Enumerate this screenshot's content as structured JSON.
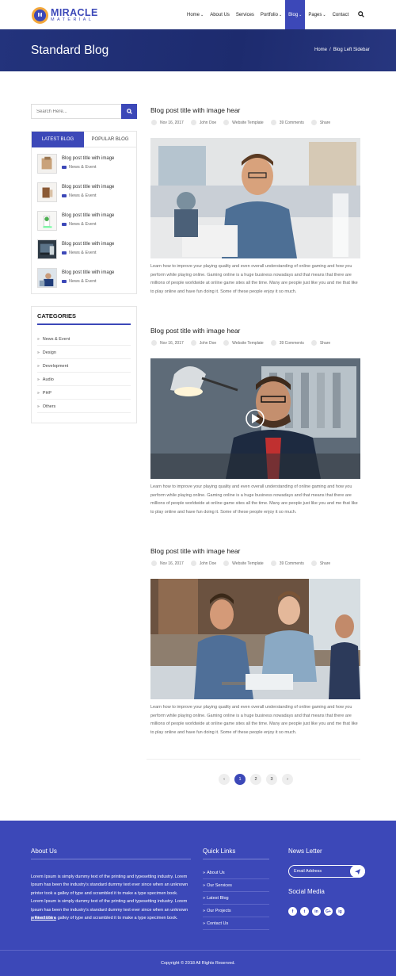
{
  "header": {
    "logo_main": "MIRACLE",
    "logo_sub": "MATERIAL",
    "logo_badge": "M",
    "nav": [
      {
        "label": "Home",
        "dropdown": true,
        "active": false
      },
      {
        "label": "About Us",
        "dropdown": false,
        "active": false
      },
      {
        "label": "Services",
        "dropdown": false,
        "active": false
      },
      {
        "label": "Portfolio",
        "dropdown": true,
        "active": false
      },
      {
        "label": "Blog",
        "dropdown": true,
        "active": true
      },
      {
        "label": "Pages",
        "dropdown": true,
        "active": false
      },
      {
        "label": "Contact",
        "dropdown": false,
        "active": false
      }
    ],
    "search_icon": "search-icon"
  },
  "banner": {
    "title": "Standard Blog",
    "breadcrumb_home": "Home",
    "breadcrumb_sep": "/",
    "breadcrumb_current": "Blog Left Sidebar"
  },
  "sidebar": {
    "search_placeholder": "Search Here...",
    "tab_latest": "LATEST BLOG",
    "tab_popular": "POPULAR BLOG",
    "posts": [
      {
        "title": "Blog post title with image",
        "category": "News & Event"
      },
      {
        "title": "Blog post title with image",
        "category": "News & Event"
      },
      {
        "title": "Blog post title with image",
        "category": "News & Event"
      },
      {
        "title": "Blog post title with image",
        "category": "News & Event"
      },
      {
        "title": "Blog post title with image",
        "category": "News & Event"
      }
    ],
    "categories_title": "CATEGORIES",
    "categories": [
      "News & Event",
      "Design",
      "Development",
      "Audio",
      "PHP",
      "Others"
    ]
  },
  "posts": [
    {
      "title": "Blog post title with image hear",
      "date": "Nov 16, 2017",
      "author": "John Doe",
      "tag": "Website Template",
      "comments": "39 Comments",
      "share": "Share",
      "has_play": false
    },
    {
      "title": "Blog post title with image hear",
      "date": "Nov 16, 2017",
      "author": "John Doe",
      "tag": "Website Template",
      "comments": "39 Comments",
      "share": "Share",
      "has_play": true
    },
    {
      "title": "Blog post title with image hear",
      "date": "Nov 16, 2017",
      "author": "John Doe",
      "tag": "Website Template",
      "comments": "39 Comments",
      "share": "Share",
      "has_play": false
    }
  ],
  "excerpt_lines": [
    "Learn how to improve your playing quality and even overall understanding of online gaming and how you",
    "perform while playing online. Gaming online is a huge business nowadays and that means that there are",
    "millions of people worldwide at online game sites all the time. Many are people just like you and me that like",
    "to play online and have fun doing it. Some of these people enjoy it so much."
  ],
  "pagination": {
    "prev": "‹",
    "pages": [
      "1",
      "2",
      "3"
    ],
    "current": "1",
    "next": "›"
  },
  "footer": {
    "about_title": "About Us",
    "about_text": "Lorem Ipsum is simply dummy text of the printing and typesetting industry. Lorem Ipsum has been the industry's standard dummy text ever since when an unknown printer took a galley of type and scrambled it to make a type specimen book. Lorem Ipsum is simply dummy text of the printing and typesetting industry. Lorem Ipsum has been the industry's standard dummy text ever since when an unknown printer took a galley of type and scrambled it to make a type specimen book.",
    "read_more": "Read More",
    "quick_title": "Quick Links",
    "quick_links": [
      "About Us",
      "Our Services",
      "Latest Blog",
      "Our Projects",
      "Contact Us"
    ],
    "newsletter_title": "News Letter",
    "newsletter_placeholder": "Email Address",
    "social_title": "Social Media",
    "social": [
      "f",
      "t",
      "in",
      "G+",
      "ig"
    ],
    "copyright": "Copyright © 2018 All Rights Reserved."
  },
  "colors": {
    "primary": "#3c48b8",
    "banner": "#1f2d72",
    "accent": "#f3a73a"
  }
}
